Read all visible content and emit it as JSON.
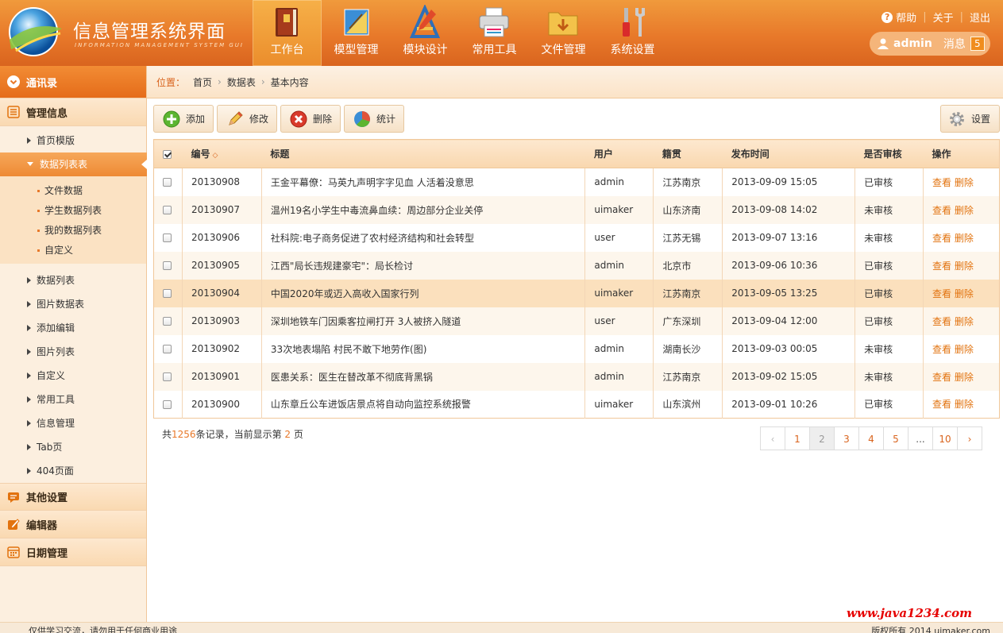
{
  "app": {
    "title": "信息管理系统界面",
    "subtitle": "INFORMATION MANAGEMENT SYSTEM GUI"
  },
  "topnav": [
    {
      "label": "工作台",
      "icon": "book-icon",
      "active": true
    },
    {
      "label": "模型管理",
      "icon": "ruler-icon",
      "active": false
    },
    {
      "label": "模块设计",
      "icon": "drafting-compass-icon",
      "active": false
    },
    {
      "label": "常用工具",
      "icon": "printer-icon",
      "active": false
    },
    {
      "label": "文件管理",
      "icon": "folder-icon",
      "active": false
    },
    {
      "label": "系统设置",
      "icon": "tools-icon",
      "active": false
    }
  ],
  "toplinks": {
    "help": "帮助",
    "about": "关于",
    "logout": "退出"
  },
  "user": {
    "name": "admin",
    "messages_label": "消息",
    "messages_count": "5"
  },
  "sidebar": {
    "contacts": "通讯录",
    "manage": "管理信息",
    "items_top": [
      "首页模版"
    ],
    "active_item": "数据列表表",
    "sub_items": [
      "文件数据",
      "学生数据列表",
      "我的数据列表",
      "自定义"
    ],
    "items_bottom": [
      "数据列表",
      "图片数据表",
      "添加编辑",
      "图片列表",
      "自定义",
      "常用工具",
      "信息管理",
      "Tab页",
      "404页面"
    ],
    "other_settings": "其他设置",
    "editor": "编辑器",
    "date_manage": "日期管理"
  },
  "breadcrumb": {
    "label": "位置：",
    "items": [
      "首页",
      "数据表",
      "基本内容"
    ]
  },
  "toolbar": {
    "add": "添加",
    "edit": "修改",
    "delete": "删除",
    "stats": "统计",
    "settings": "设置"
  },
  "table": {
    "headers": [
      "编号",
      "标题",
      "用户",
      "籍贯",
      "发布时间",
      "是否审核",
      "操作"
    ],
    "sort_symbol": "◇",
    "view_label": "查看",
    "delete_label": "删除",
    "rows": [
      {
        "id": "20130908",
        "title": "王金平幕僚：马英九声明字字见血 人活着没意思",
        "user": "admin",
        "origin": "江苏南京",
        "time": "2013-09-09 15:05",
        "status": "已审核"
      },
      {
        "id": "20130907",
        "title": "温州19名小学生中毒流鼻血续：周边部分企业关停",
        "user": "uimaker",
        "origin": "山东济南",
        "time": "2013-09-08 14:02",
        "status": "未审核"
      },
      {
        "id": "20130906",
        "title": "社科院:电子商务促进了农村经济结构和社会转型",
        "user": "user",
        "origin": "江苏无锡",
        "time": "2013-09-07 13:16",
        "status": "未审核"
      },
      {
        "id": "20130905",
        "title": "江西\"局长违规建豪宅\"：局长检讨",
        "user": "admin",
        "origin": "北京市",
        "time": "2013-09-06 10:36",
        "status": "已审核"
      },
      {
        "id": "20130904",
        "title": "中国2020年或迈入高收入国家行列",
        "user": "uimaker",
        "origin": "江苏南京",
        "time": "2013-09-05 13:25",
        "status": "已审核"
      },
      {
        "id": "20130903",
        "title": "深圳地铁车门因乘客拉闸打开 3人被挤入隧道",
        "user": "user",
        "origin": "广东深圳",
        "time": "2013-09-04 12:00",
        "status": "已审核"
      },
      {
        "id": "20130902",
        "title": "33次地表塌陷 村民不敢下地劳作(图)",
        "user": "admin",
        "origin": "湖南长沙",
        "time": "2013-09-03 00:05",
        "status": "未审核"
      },
      {
        "id": "20130901",
        "title": "医患关系：医生在替改革不彻底背黑锅",
        "user": "admin",
        "origin": "江苏南京",
        "time": "2013-09-02 15:05",
        "status": "未审核"
      },
      {
        "id": "20130900",
        "title": "山东章丘公车进饭店景点将自动向监控系统报警",
        "user": "uimaker",
        "origin": "山东滨州",
        "time": "2013-09-01 10:26",
        "status": "已审核"
      }
    ]
  },
  "summary": {
    "prefix": "共",
    "total": "1256",
    "mid": "条记录，当前显示第",
    "page": "2",
    "suffix": "页"
  },
  "pager": {
    "prev": "‹",
    "next": "›",
    "pages": [
      "1",
      "2",
      "3",
      "4",
      "5",
      "...",
      "10"
    ],
    "current": "2"
  },
  "footer": {
    "left": "仅供学习交流，请勿用于任何商业用途",
    "right": "版权所有 2014 uimaker.com"
  },
  "watermark": "www.java1234.com"
}
